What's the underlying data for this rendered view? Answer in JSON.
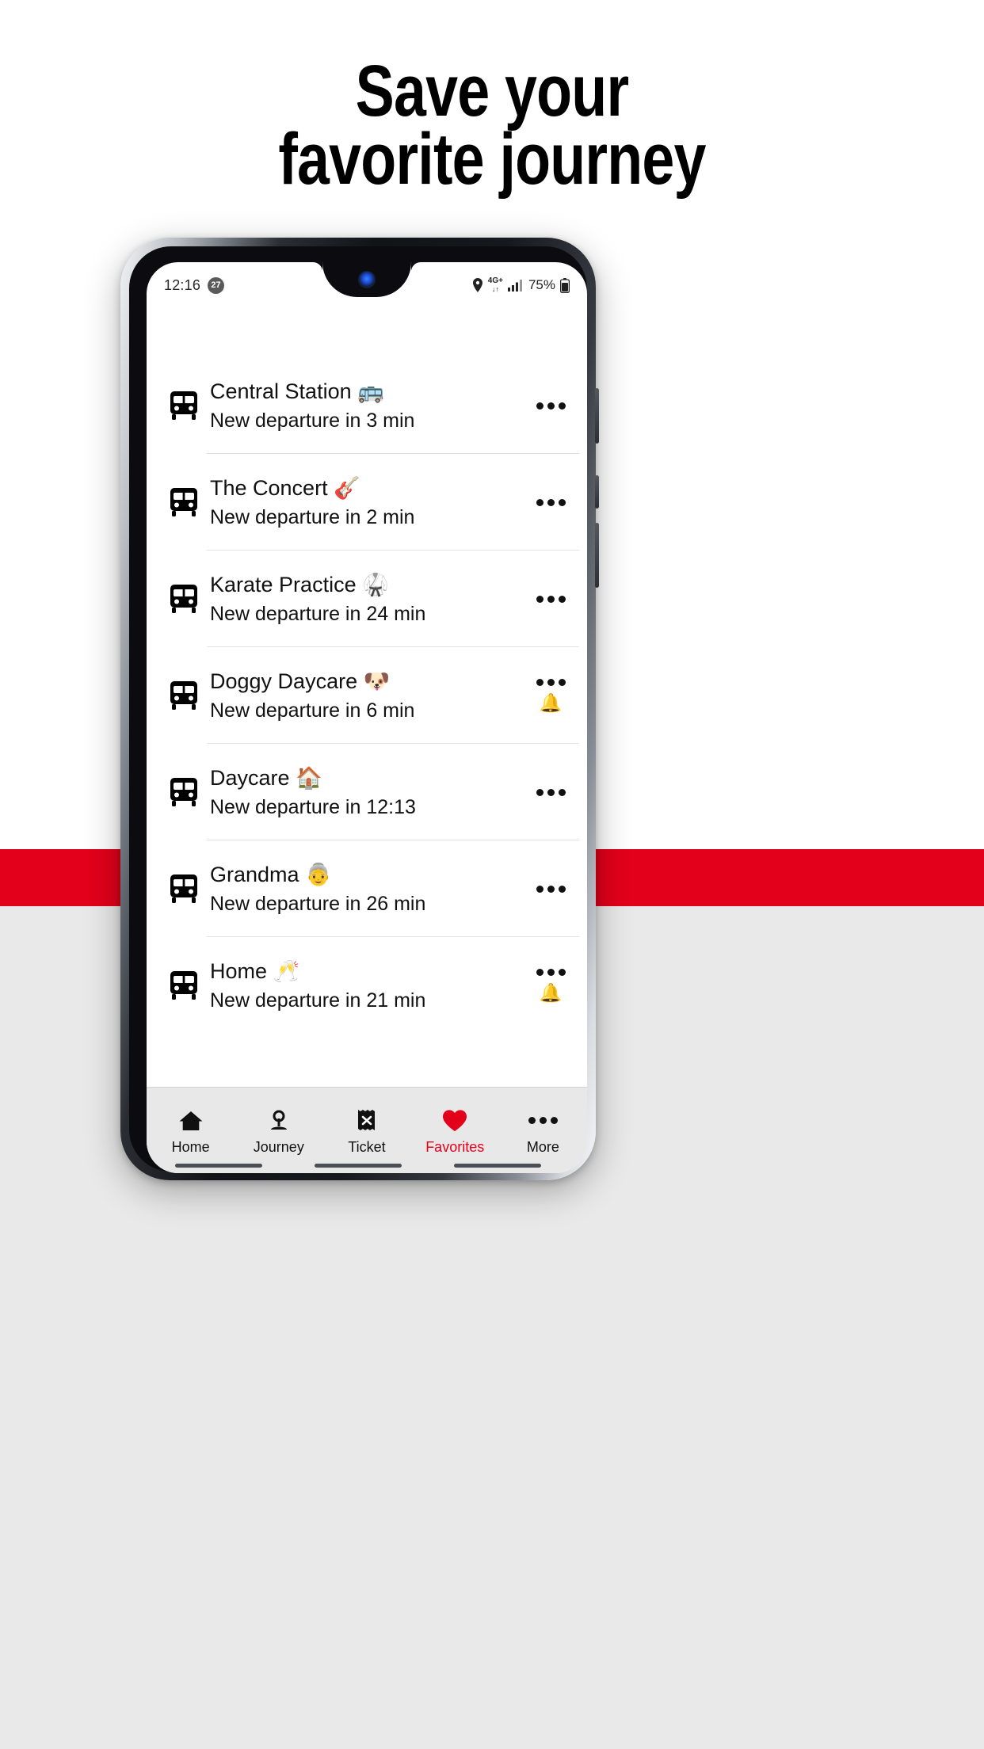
{
  "page": {
    "headline_line1": "Save your",
    "headline_line2": "favorite journey",
    "accent_color": "#e3001b",
    "band_color": "#e3001b",
    "background_color": "#e9e9e9"
  },
  "status_bar": {
    "time": "12:16",
    "notification_count": "27",
    "location_icon": "location-pin-icon",
    "network_type": "4G+",
    "data_arrows": "↓↑",
    "signal_icon": "signal-bars-icon",
    "battery_percent": "75%",
    "battery_icon": "battery-icon"
  },
  "favorites": {
    "rows": [
      {
        "icon": "bus-icon",
        "title": "Central Station 🚌",
        "subtitle": "New departure in 3 min",
        "menu": "more-options-icon",
        "alarm": ""
      },
      {
        "icon": "bus-icon",
        "title": "The Concert 🎸",
        "subtitle": "New departure in 2 min",
        "menu": "more-options-icon",
        "alarm": ""
      },
      {
        "icon": "bus-icon",
        "title": "Karate Practice 🥋",
        "subtitle": "New departure in 24 min",
        "menu": "more-options-icon",
        "alarm": ""
      },
      {
        "icon": "bus-icon",
        "title": "Doggy Daycare 🐶",
        "subtitle": "New departure in 6 min",
        "menu": "more-options-icon",
        "alarm": "🔔"
      },
      {
        "icon": "bus-icon",
        "title": "Daycare 🏠",
        "subtitle": "New departure in 12:13",
        "menu": "more-options-icon",
        "alarm": ""
      },
      {
        "icon": "bus-icon",
        "title": "Grandma 👵",
        "subtitle": "New departure in 26 min",
        "menu": "more-options-icon",
        "alarm": ""
      },
      {
        "icon": "bus-icon",
        "title": "Home 🥂",
        "subtitle": "New departure in 21 min",
        "menu": "more-options-icon",
        "alarm": "🔔"
      }
    ]
  },
  "bottom_nav": {
    "items": [
      {
        "label": "Home",
        "icon": "home-icon",
        "active": false
      },
      {
        "label": "Journey",
        "icon": "map-pin-icon",
        "active": false
      },
      {
        "label": "Ticket",
        "icon": "ticket-icon",
        "active": false
      },
      {
        "label": "Favorites",
        "icon": "heart-icon",
        "active": true
      },
      {
        "label": "More",
        "icon": "more-dots-icon",
        "active": false
      }
    ]
  }
}
